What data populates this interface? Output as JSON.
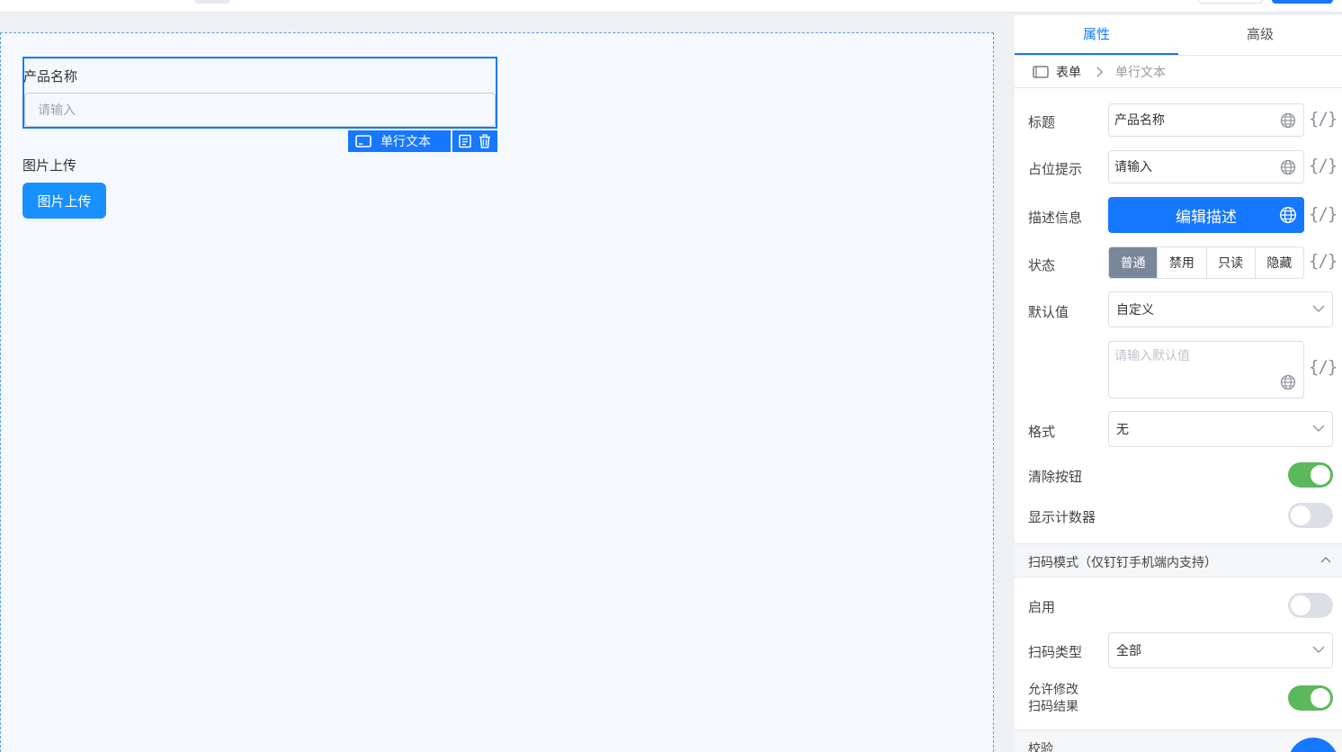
{
  "canvas": {
    "field": {
      "label": "产品名称",
      "placeholder": "请输入"
    },
    "tag": {
      "type_label": "单行文本"
    },
    "upload": {
      "label": "图片上传",
      "button": "图片上传"
    }
  },
  "panel": {
    "tabs": [
      {
        "label": "属性",
        "active": true
      },
      {
        "label": "高级",
        "active": false
      }
    ],
    "breadcrumb": {
      "root": "表单",
      "current": "单行文本"
    },
    "rows": {
      "title": {
        "label": "标题",
        "value": "产品名称"
      },
      "placeholder": {
        "label": "占位提示",
        "value": "请输入"
      },
      "description": {
        "label": "描述信息",
        "button": "编辑描述"
      },
      "state": {
        "label": "状态",
        "options": [
          "普通",
          "禁用",
          "只读",
          "隐藏"
        ],
        "selected": "普通"
      },
      "default": {
        "label": "默认值",
        "value": "自定义",
        "input_placeholder": "请输入默认值"
      },
      "format": {
        "label": "格式",
        "value": "无"
      },
      "clear_button": {
        "label": "清除按钮",
        "on": true
      },
      "show_counter": {
        "label": "显示计数器",
        "on": false
      }
    },
    "scan_section": {
      "title": "扫码模式（仅钉钉手机端内支持）"
    },
    "scan": {
      "enable": {
        "label": "启用",
        "on": false
      },
      "scan_type": {
        "label": "扫码类型",
        "value": "全部"
      },
      "allow_edit": {
        "label_line1": "允许修改",
        "label_line2": "扫码结果",
        "on": true
      }
    },
    "validation_section": {
      "title": "校验"
    },
    "expr_symbol": "{/}"
  },
  "colors": {
    "accent": "#1677ff",
    "switch_on": "#5cb85c",
    "switch_off": "#dcdfe6",
    "segment_selected": "#7a8699"
  }
}
